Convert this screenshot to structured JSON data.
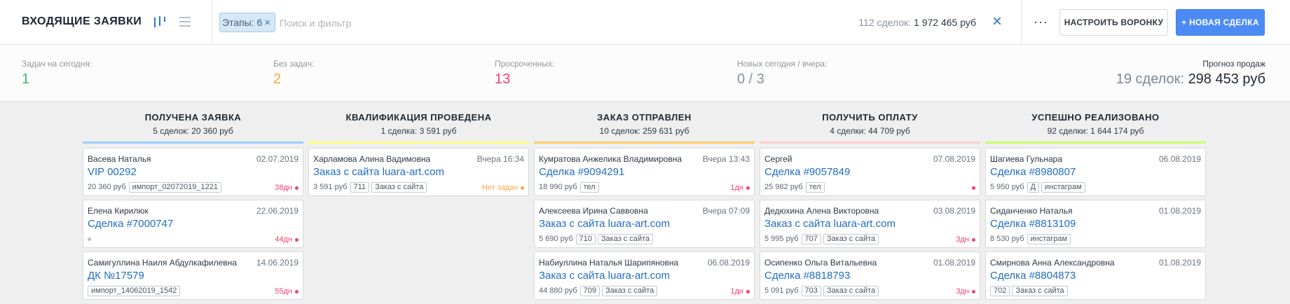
{
  "header": {
    "title": "ВХОДЯЩИЕ ЗАЯВКИ",
    "filter_chip": "Этапы: 6",
    "filter_chip_remove": "×",
    "search_placeholder": "Поиск и фильтр",
    "summary_count": "112 сделок:",
    "summary_sum": "1 972 465 руб",
    "clear": "×",
    "more": "···",
    "btn_funnel": "НАСТРОИТЬ ВОРОНКУ",
    "btn_new": "+ НОВАЯ СДЕЛКА"
  },
  "stats": [
    {
      "label": "Задач на сегодня:",
      "value": "1",
      "color": "#2ebd6e"
    },
    {
      "label": "Без задач:",
      "value": "2",
      "color": "#f5a740"
    },
    {
      "label": "Просроченных:",
      "value": "13",
      "color": "#f5416c"
    },
    {
      "label": "Новых сегодня / вчера:",
      "value": "0 / 3",
      "color": "#8491a0"
    }
  ],
  "forecast": {
    "label": "Прогноз продаж",
    "count": "19 сделок:",
    "sum": "298 453 руб"
  },
  "columns": [
    {
      "title": "ПОЛУЧЕНА ЗАЯВКА",
      "summary": "5 сделок: 20 360 руб",
      "color": "#99ccff",
      "cards": [
        {
          "name": "Васева Наталья",
          "date": "02.07.2019",
          "deal": "VIP 00292",
          "price": "20 360 руб",
          "tags": [
            "импорт_02072019_1221"
          ],
          "status": "38дн",
          "status_color": "#f5416c"
        },
        {
          "name": "Елена Кирилюк",
          "date": "22.06.2019",
          "deal": "Сделка #7000747",
          "price": "",
          "tags": [],
          "grey_dot": true,
          "status": "44дн",
          "status_color": "#f5416c"
        },
        {
          "name": "Самигуллина Наиля Абдулкафилевна",
          "date": "14.06.2019",
          "deal": "ДК №17579",
          "price": "",
          "tags": [
            "импорт_14062019_1542"
          ],
          "status": "55дн",
          "status_color": "#f5416c"
        }
      ]
    },
    {
      "title": "КВАЛИФИКАЦИЯ ПРОВЕДЕНА",
      "summary": "1 сделка: 3 591 руб",
      "color": "#fffd7f",
      "cards": [
        {
          "name": "Харламова Алина Вадимовна",
          "date": "Вчера 16:34",
          "deal": "Заказ с сайта luara-art.com",
          "price": "3 591 руб",
          "tags": [
            "711",
            "Заказ с сайта"
          ],
          "status": "Нет задач",
          "status_color": "#f5a740"
        }
      ]
    },
    {
      "title": "ЗАКАЗ ОТПРАВЛЕН",
      "summary": "10 сделок: 259 631 руб",
      "color": "#ffcc66",
      "cards": [
        {
          "name": "Кумратова Анжелика Владимировна",
          "date": "Вчера 13:43",
          "deal": "Сделка #9094291",
          "price": "18 990 руб",
          "tags": [
            "тел"
          ],
          "status": "1дн",
          "status_color": "#f5416c"
        },
        {
          "name": "Алексеева Ирина Саввовна",
          "date": "Вчера 07:09",
          "deal": "Заказ с сайта luara-art.com",
          "price": "5 690 руб",
          "tags": [
            "710",
            "Заказ с сайта"
          ],
          "status": "",
          "status_color": ""
        },
        {
          "name": "Набиуллина Наталья Шарипяновна",
          "date": "06.08.2019",
          "deal": "Заказ с сайта luara-art.com",
          "price": "44 880 руб",
          "tags": [
            "709",
            "Заказ с сайта"
          ],
          "status": "1дн",
          "status_color": "#f5416c"
        }
      ]
    },
    {
      "title": "ПОЛУЧИТЬ ОПЛАТУ",
      "summary": "4 сделки: 44 709 руб",
      "color": "#ffcccc",
      "cards": [
        {
          "name": "Сергей",
          "date": "07.08.2019",
          "deal": "Сделка #9057849",
          "price": "25 982 руб",
          "tags": [
            "тел"
          ],
          "status": "",
          "status_color": "#f5416c",
          "dot_only": true
        },
        {
          "name": "Дедюхина Алена Викторовна",
          "date": "03.08.2019",
          "deal": "Заказ с сайта luara-art.com",
          "price": "5 995 руб",
          "tags": [
            "707",
            "Заказ с сайта"
          ],
          "status": "3дн",
          "status_color": "#f5416c"
        },
        {
          "name": "Осипенко Ольга Витальевна",
          "date": "01.08.2019",
          "deal": "Сделка #8818793",
          "price": "5 091 руб",
          "tags": [
            "703",
            "Заказ с сайта"
          ],
          "status": "3дн",
          "status_color": "#f5416c"
        }
      ]
    },
    {
      "title": "УСПЕШНО РЕАЛИЗОВАНО",
      "summary": "92 сделки: 1 644 174 руб",
      "color": "#ccff66",
      "cards": [
        {
          "name": "Шагиева Гульнара",
          "date": "06.08.2019",
          "deal": "Сделка #8980807",
          "price": "5 950 руб",
          "tags": [
            "Д",
            "инстаграм"
          ],
          "status": "",
          "status_color": ""
        },
        {
          "name": "Сиданченко Наталья",
          "date": "01.08.2019",
          "deal": "Сделка #8813109",
          "price": "8 530 руб",
          "tags": [
            "инстаграм"
          ],
          "status": "",
          "status_color": ""
        },
        {
          "name": "Смирнова Анна Александровна",
          "date": "01.08.2019",
          "deal": "Сделка #8804873",
          "price": "",
          "tags": [
            "702",
            "Заказ с сайта"
          ],
          "status": "",
          "status_color": ""
        }
      ]
    }
  ]
}
